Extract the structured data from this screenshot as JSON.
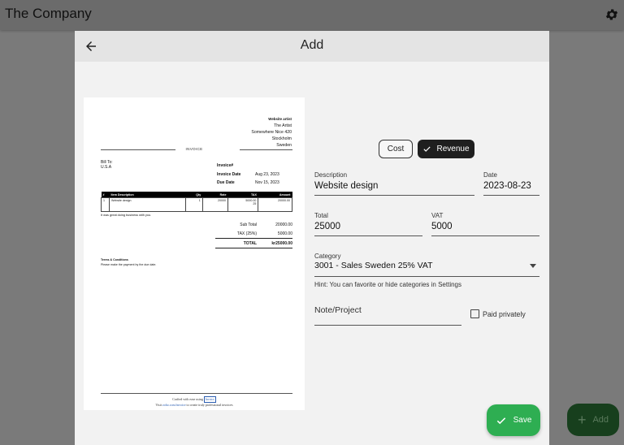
{
  "app": {
    "title": "The Company",
    "settings_icon": "gear-icon"
  },
  "background_fab": {
    "label": "Add",
    "icon": "plus-icon"
  },
  "dialog": {
    "title": "Add",
    "back_icon": "arrow-left-icon"
  },
  "invoice": {
    "from_label": "Website artist",
    "from_lines": [
      "The Artist",
      "Somewhere Nice 420",
      "Stockholm",
      "Sweden"
    ],
    "doc_title": "INVOICE",
    "bill_to_label": "Bill To:",
    "bill_to_value": "U.S.A",
    "meta": [
      {
        "k": "Invoice#",
        "v": ""
      },
      {
        "k": "Invoice Date",
        "v": "Aug 23, 2023"
      },
      {
        "k": "Due Date",
        "v": "Nov 15, 2023"
      }
    ],
    "columns": [
      "#",
      "Item Description",
      "Qty",
      "Rate",
      "TAX",
      "Amount"
    ],
    "row": {
      "n": "1",
      "desc": "Website design",
      "qty": "1",
      "rate": "20000",
      "tax": "5000.00",
      "tax_pct": "25",
      "amount": "20000.00"
    },
    "thanks": "It was great doing business with you.",
    "totals": [
      {
        "label": "Sub Total",
        "value": "20000.00"
      },
      {
        "label": "TAX (25%)",
        "value": "5000.00"
      },
      {
        "label": "TOTAL",
        "value": "kr25000.00"
      }
    ],
    "terms_title": "Terms & Conditions",
    "terms_text": "Please make the payment by the due date.",
    "footer_line1": "Crafted with ease using",
    "footer_brand": "Invoice",
    "footer_line2_pre": "Visit",
    "footer_link": "zoho.com/invoice",
    "footer_line2_post": "to create truly professional invoices"
  },
  "form": {
    "type_cost": "Cost",
    "type_revenue": "Revenue",
    "selected_type": "Revenue",
    "description_label": "Description",
    "description_value": "Website design",
    "date_label": "Date",
    "date_value": "2023-08-23",
    "total_label": "Total",
    "total_value": "25000",
    "vat_label": "VAT",
    "vat_value": "5000",
    "category_label": "Category",
    "category_value": "3001 - Sales Sweden 25% VAT",
    "hint": "Hint: You can favorite or hide categories in Settings",
    "note_label": "Note/Project",
    "paid_privately_label": "Paid privately",
    "paid_privately_checked": false,
    "save_label": "Save"
  },
  "colors": {
    "save": "#2eae52",
    "selected_segment": "#1f1f1f",
    "header": "#e4e4e4"
  }
}
